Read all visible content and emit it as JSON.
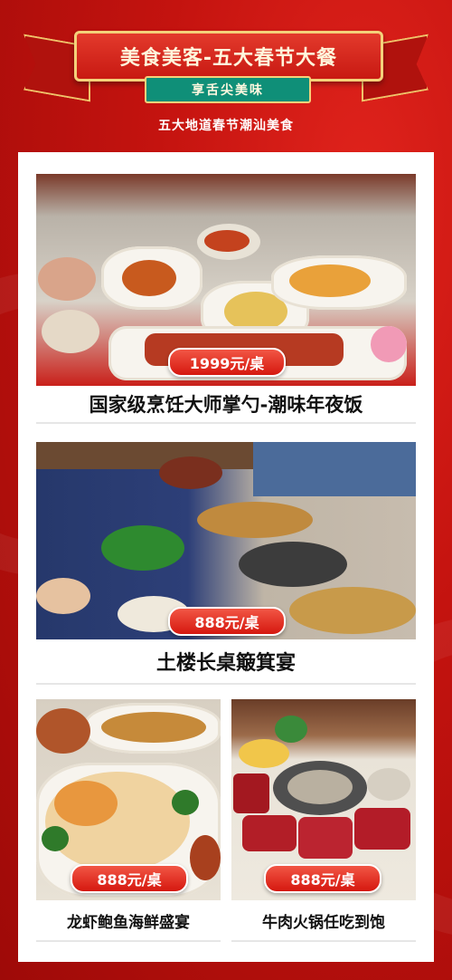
{
  "banner": {
    "title": "美食美客-五大春节大餐",
    "subtitle": "享舌尖美味",
    "caption": "五大地道春节潮汕美食"
  },
  "colors": {
    "background": "#c4130f",
    "ribbon": "#c81912",
    "subribbon": "#0f8f78",
    "price_badge": "#e0271c",
    "gold_border": "#f4d17a"
  },
  "feasts": [
    {
      "price": "1999元/桌",
      "name": "国家级烹饪大师掌勺-潮味年夜饭"
    },
    {
      "price": "888元/桌",
      "name": "土楼长桌簸箕宴"
    },
    {
      "price": "888元/桌",
      "name": "龙虾鲍鱼海鲜盛宴"
    },
    {
      "price": "888元/桌",
      "name": "牛肉火锅任吃到饱"
    }
  ]
}
